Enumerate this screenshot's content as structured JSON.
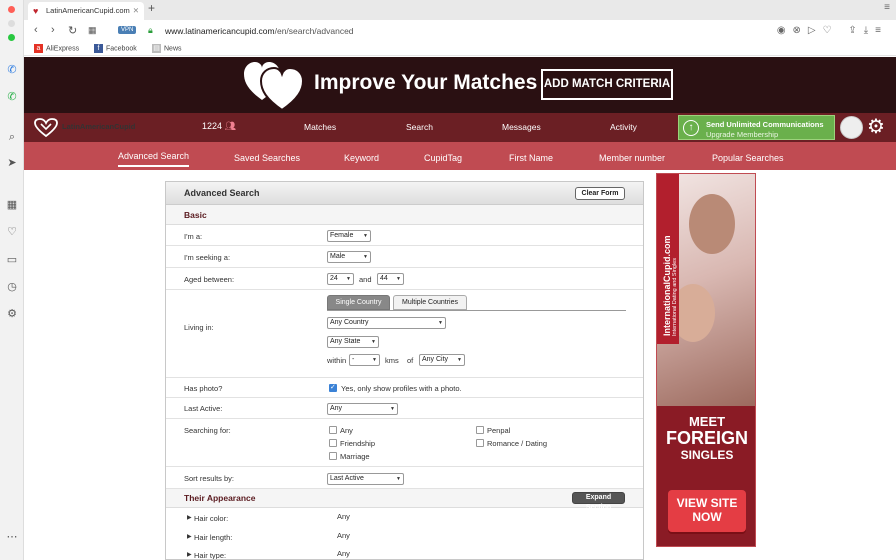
{
  "browser": {
    "tab_title": "LatinAmericanCupid.com",
    "url_host": "www.latinamericancupid.com",
    "url_path": "/en/search/advanced",
    "vpn_label": "VPN",
    "bookmarks": [
      "AliExpress",
      "Facebook",
      "News"
    ]
  },
  "banner": {
    "headline": "Improve Your Matches",
    "cta": "ADD MATCH CRITERIA"
  },
  "nav": {
    "logo": "LatinAmericanCupid",
    "count": "1224",
    "items": [
      "Matches",
      "Search",
      "Messages",
      "Activity"
    ],
    "upgrade_line1": "Send Unlimited Communications",
    "upgrade_line2": "Upgrade Membership"
  },
  "subnav": {
    "items": [
      "Advanced Search",
      "Saved Searches",
      "Keyword",
      "CupidTag",
      "First Name",
      "Member number",
      "Popular Searches"
    ]
  },
  "form": {
    "title": "Advanced Search",
    "clear_btn": "Clear Form",
    "basic_title": "Basic",
    "im_a_label": "I'm a:",
    "im_a_value": "Female",
    "seeking_label": "I'm seeking a:",
    "seeking_value": "Male",
    "aged_label": "Aged between:",
    "age_from": "24",
    "age_and": "and",
    "age_to": "44",
    "living_label": "Living in:",
    "tab_single": "Single Country",
    "tab_multiple": "Multiple Countries",
    "country": "Any Country",
    "state": "Any State",
    "within": "within",
    "within_value": "-",
    "kms": "kms",
    "of": "of",
    "city": "Any City",
    "photo_label": "Has photo?",
    "photo_text": "Yes, only show profiles with a photo.",
    "last_active_label": "Last Active:",
    "last_active_value": "Any",
    "searching_label": "Searching for:",
    "searching_options": [
      "Any",
      "Penpal",
      "Friendship",
      "Romance / Dating",
      "Marriage"
    ],
    "sort_label": "Sort results by:",
    "sort_value": "Last Active",
    "appearance_title": "Their Appearance",
    "expand_btn": "Expand Section",
    "hair_color_label": "Hair color:",
    "hair_color_value": "Any",
    "hair_length_label": "Hair length:",
    "hair_length_value": "Any",
    "hair_type_label": "Hair type:",
    "hair_type_value": "Any"
  },
  "ad": {
    "vertical_text": "InternationalCupid.com",
    "vertical_sub": "International Dating and Singles",
    "meet": "MEET",
    "foreign": "FOREIGN",
    "singles": "SINGLES",
    "cta_line1": "VIEW SITE",
    "cta_line2": "NOW"
  },
  "colors": {
    "nav_bg": "#6b1f24",
    "subnav_bg": "#c04b52",
    "banner_bg": "#2a1012",
    "upgrade_green": "#6ab04c"
  }
}
